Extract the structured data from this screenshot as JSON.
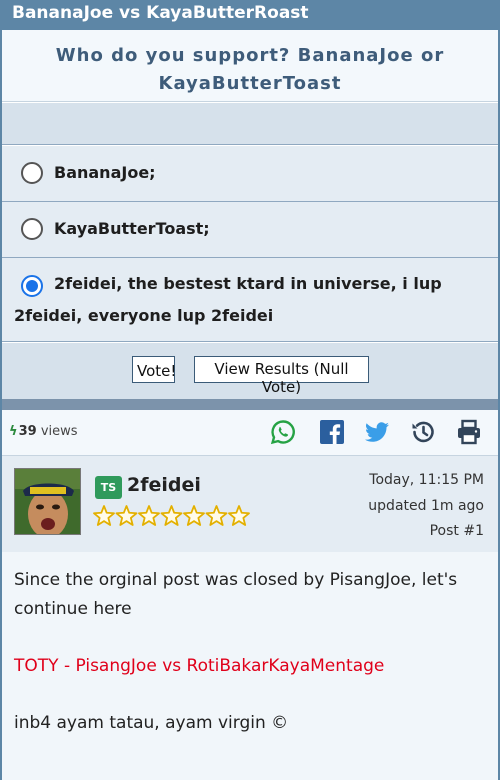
{
  "thread": {
    "title": "BananaJoe vs KayaButterRoast"
  },
  "poll": {
    "question": "Who do you support? BananaJoe or KayaButterToast",
    "options": [
      {
        "label": "BananaJoe;",
        "selected": false
      },
      {
        "label": "KayaButterToast;",
        "selected": false
      },
      {
        "label": "2feidei, the bestest ktard in universe, i lup 2feidei, everyone lup 2feidei",
        "selected": true
      }
    ],
    "vote_label": "Vote!",
    "results_label": "View Results (Null Vote)"
  },
  "stats": {
    "views_count": "39",
    "views_label": "views",
    "icons": [
      "whatsapp-icon",
      "facebook-icon",
      "twitter-icon",
      "history-icon",
      "print-icon"
    ]
  },
  "post": {
    "badge": "TS",
    "username": "2feidei",
    "star_count": 7,
    "time": "Today, 11:15 PM",
    "updated": "updated 1m ago",
    "post_number": "Post #1",
    "paragraphs": [
      "Since the orginal post was closed by PisangJoe, let's continue here",
      "TOTY - PisangJoe vs RotiBakarKayaMentage",
      "inb4 ayam tatau, ayam virgin ©"
    ]
  },
  "colors": {
    "accent": "#5d86a6",
    "link_red": "#e0001a",
    "whatsapp": "#25a244",
    "facebook": "#2b5f9e",
    "twitter": "#3a9ee8",
    "dark_icon": "#33455a"
  }
}
